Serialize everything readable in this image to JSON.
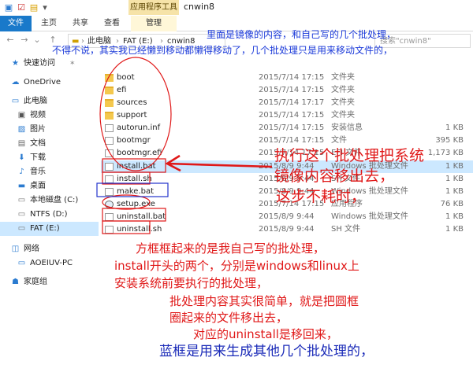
{
  "window": {
    "title": "cnwin8",
    "context_tab": "应用程序工具"
  },
  "ribbon": {
    "tabs": [
      "文件",
      "主页",
      "共享",
      "查看",
      "管理"
    ]
  },
  "address": {
    "crumbs": [
      "此电脑",
      "FAT (E:)",
      "cnwin8"
    ],
    "search_placeholder": "搜索\"cnwin8\""
  },
  "sidebar": {
    "items": [
      {
        "label": "快速访问",
        "icon": "star-icon"
      },
      {
        "label": "OneDrive",
        "icon": "cloud-icon"
      },
      {
        "label": "此电脑",
        "icon": "computer-icon"
      },
      {
        "label": "视频",
        "icon": "video-icon"
      },
      {
        "label": "图片",
        "icon": "picture-icon"
      },
      {
        "label": "文档",
        "icon": "document-icon"
      },
      {
        "label": "下载",
        "icon": "download-icon"
      },
      {
        "label": "音乐",
        "icon": "music-icon"
      },
      {
        "label": "桌面",
        "icon": "desktop-icon"
      },
      {
        "label": "本地磁盘 (C:)",
        "icon": "drive-icon"
      },
      {
        "label": "NTFS (D:)",
        "icon": "drive-icon"
      },
      {
        "label": "FAT (E:)",
        "icon": "drive-icon"
      },
      {
        "label": "网络",
        "icon": "network-icon"
      },
      {
        "label": "AOEIUV-PC",
        "icon": "computer-icon"
      },
      {
        "label": "家庭组",
        "icon": "homegroup-icon"
      }
    ]
  },
  "files": [
    {
      "name": "boot",
      "date": "2015/7/14 17:15",
      "type": "文件夹",
      "size": "",
      "icon": "folder"
    },
    {
      "name": "efi",
      "date": "2015/7/14 17:15",
      "type": "文件夹",
      "size": "",
      "icon": "folder"
    },
    {
      "name": "sources",
      "date": "2015/7/14 17:17",
      "type": "文件夹",
      "size": "",
      "icon": "folder"
    },
    {
      "name": "support",
      "date": "2015/7/14 17:15",
      "type": "文件夹",
      "size": "",
      "icon": "folder"
    },
    {
      "name": "autorun.inf",
      "date": "2015/7/14 17:15",
      "type": "安装信息",
      "size": "1 KB",
      "icon": "file"
    },
    {
      "name": "bootmgr",
      "date": "2015/7/14 17:15",
      "type": "文件",
      "size": "395 KB",
      "icon": "file"
    },
    {
      "name": "bootmgr.efi",
      "date": "2015/7/14 17:15",
      "type": "EFI 文件",
      "size": "1,173 KB",
      "icon": "file"
    },
    {
      "name": "install.bat",
      "date": "2015/8/9 9:44",
      "type": "Windows 批处理文件",
      "size": "1 KB",
      "icon": "file"
    },
    {
      "name": "install.sh",
      "date": "2015/8/9 9:44",
      "type": "SH 文件",
      "size": "1 KB",
      "icon": "file"
    },
    {
      "name": "make.bat",
      "date": "2015/8/9 9:44",
      "type": "Windows 批处理文件",
      "size": "1 KB",
      "icon": "file"
    },
    {
      "name": "setup.exe",
      "date": "2015/7/14 17:15",
      "type": "应用程序",
      "size": "76 KB",
      "icon": "exe"
    },
    {
      "name": "uninstall.bat",
      "date": "2015/8/9 9:44",
      "type": "Windows 批处理文件",
      "size": "1 KB",
      "icon": "file"
    },
    {
      "name": "uninstall.sh",
      "date": "2015/8/9 9:44",
      "type": "SH 文件",
      "size": "1 KB",
      "icon": "file"
    }
  ],
  "annotations": {
    "top_line1": "里面是镜像的内容，和自己写的几个批处理，",
    "top_line2": "不得不说，其实我已经懒到移动都懒得移动了，几个批处理只是用来移动文件的，",
    "right_line1": "执行这个批处理把系统",
    "right_line2": "镜像内容移出去，",
    "right_line3": "这步不耗时，",
    "mid_line1": "方框框起来的是我自己写的批处理，",
    "mid_line2": "install开头的两个，分别是windows和linux上",
    "mid_line3": "安装系统前要执行的批处理，",
    "mid_line4": "批处理内容其实很简单，就是把圆框",
    "mid_line5": "圈起来的文件移出去，",
    "mid_line6": "对应的uninstall是移回来，",
    "bottom_line": "蓝框是用来生成其他几个批处理的，"
  }
}
